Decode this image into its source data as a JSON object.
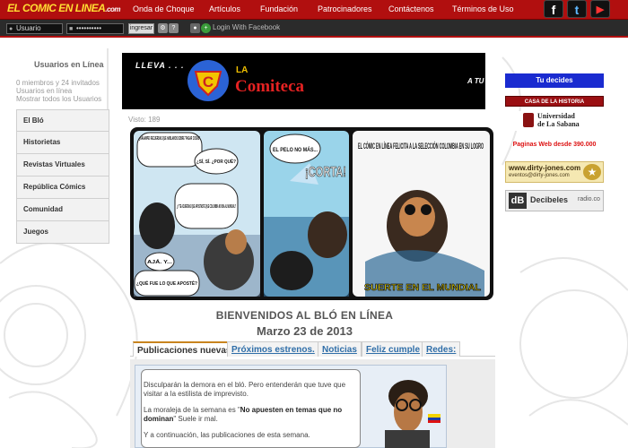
{
  "header": {
    "logo_main": "EL COMIC EN LINEA",
    "logo_suffix": ".com",
    "nav": [
      "Onda de Choque",
      "Artículos",
      "Fundación",
      "Patrocinadores",
      "Contáctenos",
      "Términos de Uso"
    ],
    "social": [
      {
        "icon": "facebook-icon",
        "glyph": "f"
      },
      {
        "icon": "twitter-icon",
        "glyph": "t"
      },
      {
        "icon": "youtube-icon",
        "glyph": "▶"
      }
    ]
  },
  "login": {
    "user_value": "Usuario",
    "password_value": "••••••••••",
    "submit_label": "ingresar",
    "facebook_label": "Login With Facebook"
  },
  "sidebar": {
    "online_title": "Usuarios en Línea",
    "online_lines": [
      "0 miembros y 24 invitados",
      "Usuarios en línea",
      "Mostrar todos los Usuarios"
    ],
    "menu": [
      "El Bló",
      "Historietas",
      "Revistas Virtuales",
      "República Cómics",
      "Comunidad",
      "Juegos"
    ]
  },
  "banner": {
    "lead": "LLEVA . . .",
    "la": "LA",
    "name": "Comiteca",
    "tail": "A TU",
    "shield_letter": "C"
  },
  "main": {
    "visto": "Visto: 189",
    "comic": {
      "panel1": [
        "¿AAAAMPE! RECUERDAS QUE HABLAMOS SOBRE \"PAGAR COSAS\"",
        "¿SÍ, SÍ. ¿POR QUÉ?",
        "¿Y TE ACUERDAS QUE APOSTASTE QUE COLOMBIA NO IBA AL MUNDIAL?",
        "AJÁ. Y...",
        "¿QUÉ FUE LO QUE APOSTÉ?"
      ],
      "panel2": [
        "EL PELO NO MÁS...",
        "¡CORTA!"
      ],
      "panel3": [
        "EL CÓMIC EN LÍNEA FELICITA A LA SELECCIÓN COLOMBIA EN SU LOGRO",
        "SUERTE EN EL MUNDIAL"
      ]
    },
    "title": "BIENVENIDOS AL BLÓ EN LÍNEA",
    "date": "Marzo 23 de 2013",
    "tabs": [
      "Publicaciones nuevas",
      "Próximos estrenos.",
      "Noticias",
      "Feliz cumple",
      "Redes:"
    ],
    "post": {
      "p1": "Disculparán la demora en el bló. Pero entenderán que tuve que visitar a la estilista de imprevisto.",
      "p2_pre": "La moraleja de la semana es \"",
      "p2_bold": "No apuesten en temas que no dominan",
      "p2_post": "\" Suele ir mal.",
      "p3": "Y a continuación, las publicaciones de esta semana."
    }
  },
  "ads": {
    "tu_decides": "Tu decides",
    "casa": "CASA DE LA HISTORIA",
    "sabana_line1": "Universidad",
    "sabana_line2": "de La Sabana",
    "paginas": "Paginas Web desde 390.000",
    "dirty_line1": "www.dirty-jones.com",
    "dirty_line2": "eventos@dirty-jones.com",
    "decibeles_logo": "dB",
    "decibeles_text": "Decibeles",
    "decibeles_suffix": "radio.co"
  },
  "colors": {
    "brand_red": "#b10f0f",
    "link_blue": "#2f6ea8",
    "tab_accent": "#c8841f",
    "sidebar_bg": "#f2f2f2"
  }
}
